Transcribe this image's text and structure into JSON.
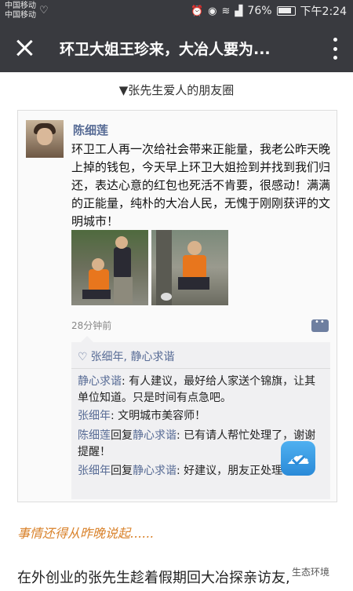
{
  "status_bar": {
    "carrier_1": "中国移动",
    "carrier_2": "中国移动",
    "battery": "76%",
    "time": "下午2:24",
    "icons": [
      "heart-pulse-icon",
      "alarm-icon",
      "eye-icon",
      "wifi-icon",
      "signal-icon",
      "battery-icon"
    ]
  },
  "header": {
    "title": "环卫大姐王珍来，大冶人要为..."
  },
  "article": {
    "caption": "▼张先生爱人的朋友圈",
    "moment": {
      "poster": "陈细莲",
      "text": "环卫工人再一次给社会带来正能量，我老公昨天晚上掉的钱包，今天早上环卫大姐捡到并找到我们归还，表达心意的红包也死活不肯要，很感动！满满的正能量，纯朴的大冶人民，无愧于刚刚获评的文明城市！",
      "timestamp": "28分钟前",
      "likes": "张细年, 静心求谐",
      "comments": [
        {
          "name": "静心求谐",
          "text": ": 有人建议，最好给人家送个锦旗，让其单位知道。只是时间有点急吧。"
        },
        {
          "name": "张细年",
          "text": ": 文明城市美容师！"
        },
        {
          "name": "陈细莲",
          "reply_word": "回复",
          "reply_to": "静心求谐",
          "text": ": 已有请人帮忙处理了，谢谢提醒！"
        },
        {
          "name": "张细年",
          "reply_word": "回复",
          "reply_to": "静心求谐",
          "text": ": 好建议，朋友正处理！"
        }
      ]
    },
    "intro": "事情还得从昨晚说起......",
    "body_start": "在外创业的张先生趁着假期回大冶探亲访友,",
    "watermark": "生态环境"
  },
  "colors": {
    "top_bar": "#393a3f",
    "link_blue": "#576b95",
    "intro_orange": "#d9822b"
  }
}
